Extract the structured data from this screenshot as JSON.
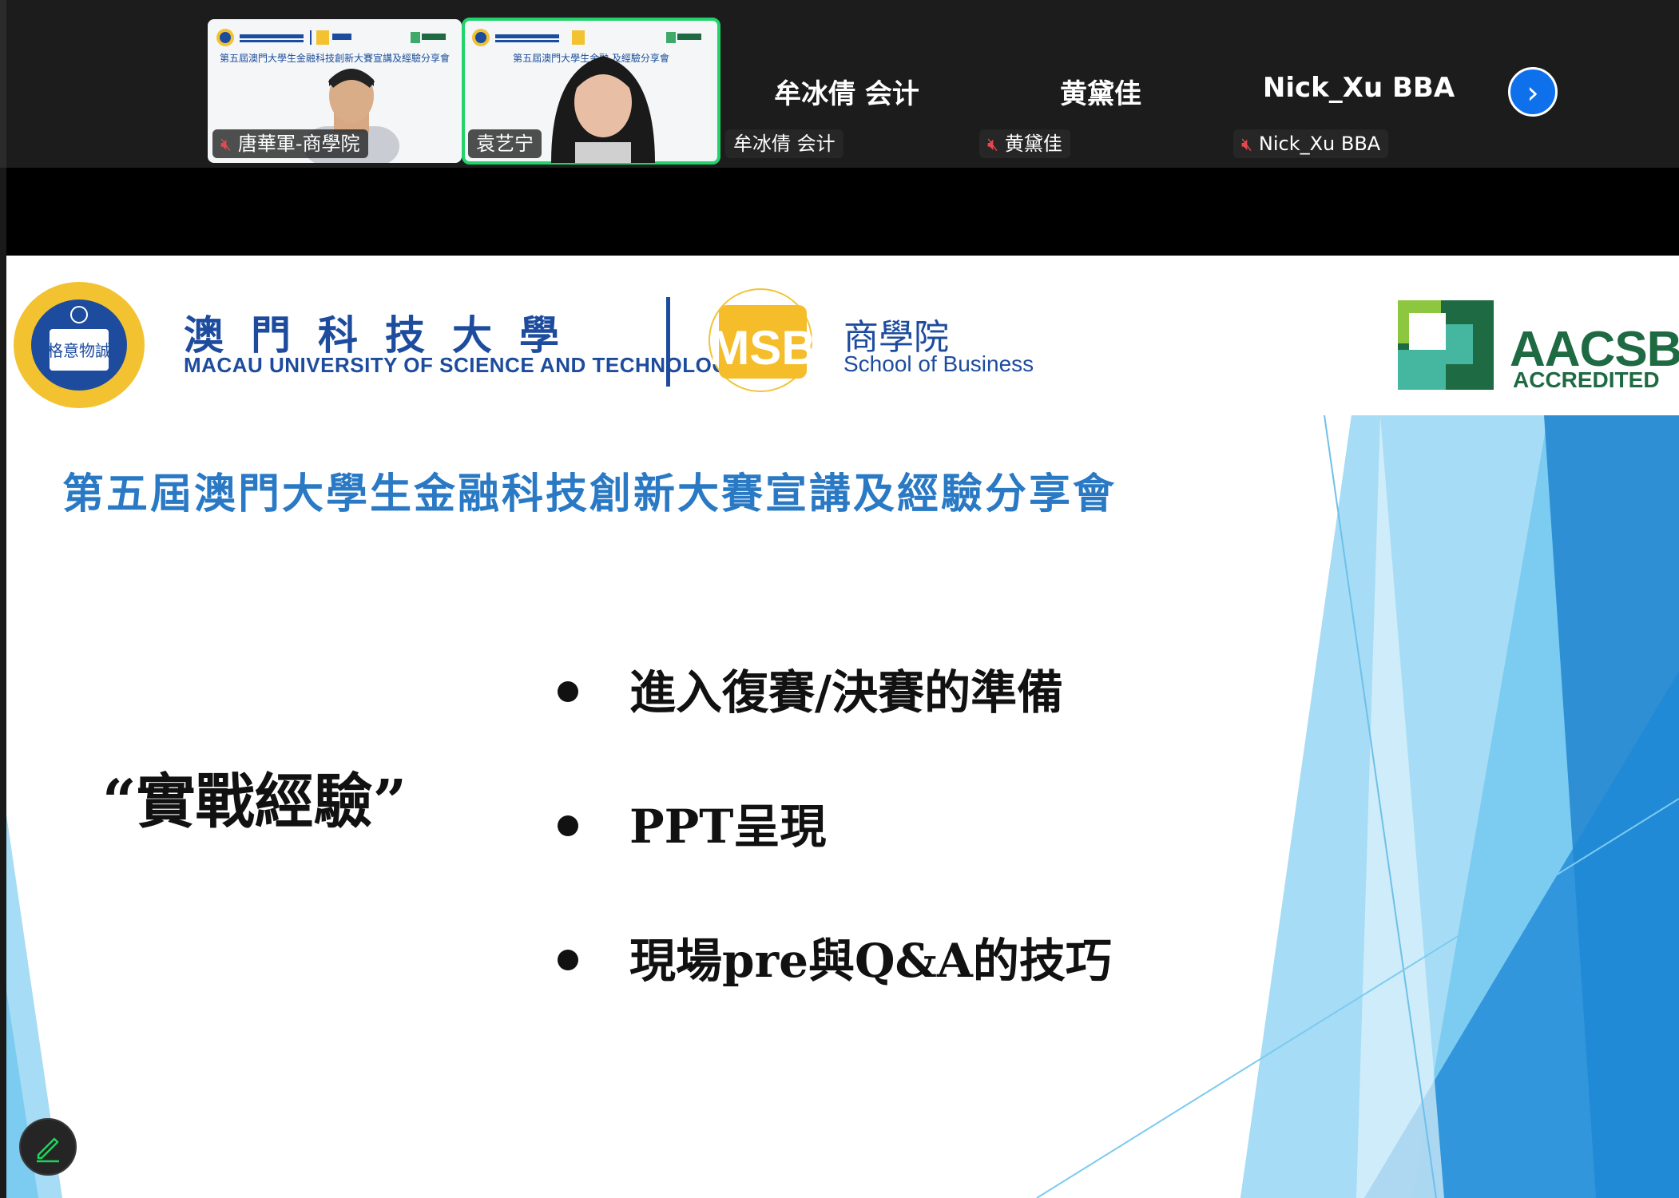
{
  "participants": [
    {
      "name": "唐華軍-商學院",
      "muted": true,
      "video": true,
      "slide_title_mini": "第五屆澳門大學生金融科技創新大賽宣講及經驗分享會"
    },
    {
      "name": "袁艺宁",
      "muted": false,
      "video": true,
      "active": true,
      "slide_title_mini": "第五屆澳門大學生金融    及經驗分享會"
    },
    {
      "name": "牟冰倩 会计",
      "big_name": "牟冰倩 会计",
      "muted": false,
      "video": false
    },
    {
      "name": "黄黛佳",
      "big_name": "黄黛佳",
      "muted": true,
      "video": false
    },
    {
      "name": "Nick_Xu BBA",
      "big_name": "Nick_Xu BBA",
      "muted": true,
      "video": false
    }
  ],
  "icons": {
    "next": "chevron-right-icon",
    "mute": "muted-mic-icon",
    "pen": "pencil-icon"
  },
  "slide": {
    "univ_cn": "澳門科技大學",
    "univ_en": "MACAU UNIVERSITY OF SCIENCE AND TECHNOLOGY",
    "seal_text": "格意物誠",
    "msb_logo": "MSB",
    "msb_cn": "商學院",
    "msb_en": "School of Business",
    "aacsb_main": "AACSB",
    "aacsb_sub": "ACCREDITED",
    "title": "第五屆澳門大學生金融科技創新大賽宣講及經驗分享會",
    "quote": "“實戰經驗”",
    "bullets": [
      "進入復賽/決賽的準備",
      "PPT呈現",
      "現場pre與Q&A的技巧"
    ]
  },
  "colors": {
    "accent_blue": "#1d4c9e",
    "title_blue": "#2a79c4",
    "active_border": "#22d36b",
    "zoom_blue": "#0e71eb",
    "aacsb_green": "#1e6a43"
  }
}
